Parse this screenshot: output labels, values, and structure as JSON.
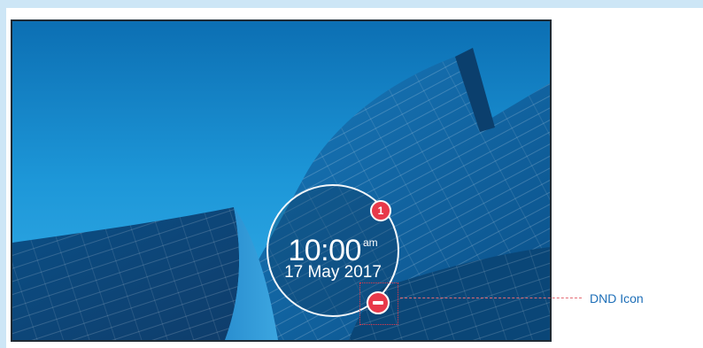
{
  "lock_screen": {
    "time": "10:00",
    "ampm": "am",
    "date": "17 May 2017",
    "notification_count": "1",
    "dnd_icon_name": "minus-circle-icon"
  },
  "annotation": {
    "dnd_label": "DND Icon"
  },
  "colors": {
    "accent_red": "#e8394a",
    "wallpaper_blue": "#1b8fd0",
    "label_blue": "#1e6fb8",
    "frame_band": "#cde6f6"
  }
}
